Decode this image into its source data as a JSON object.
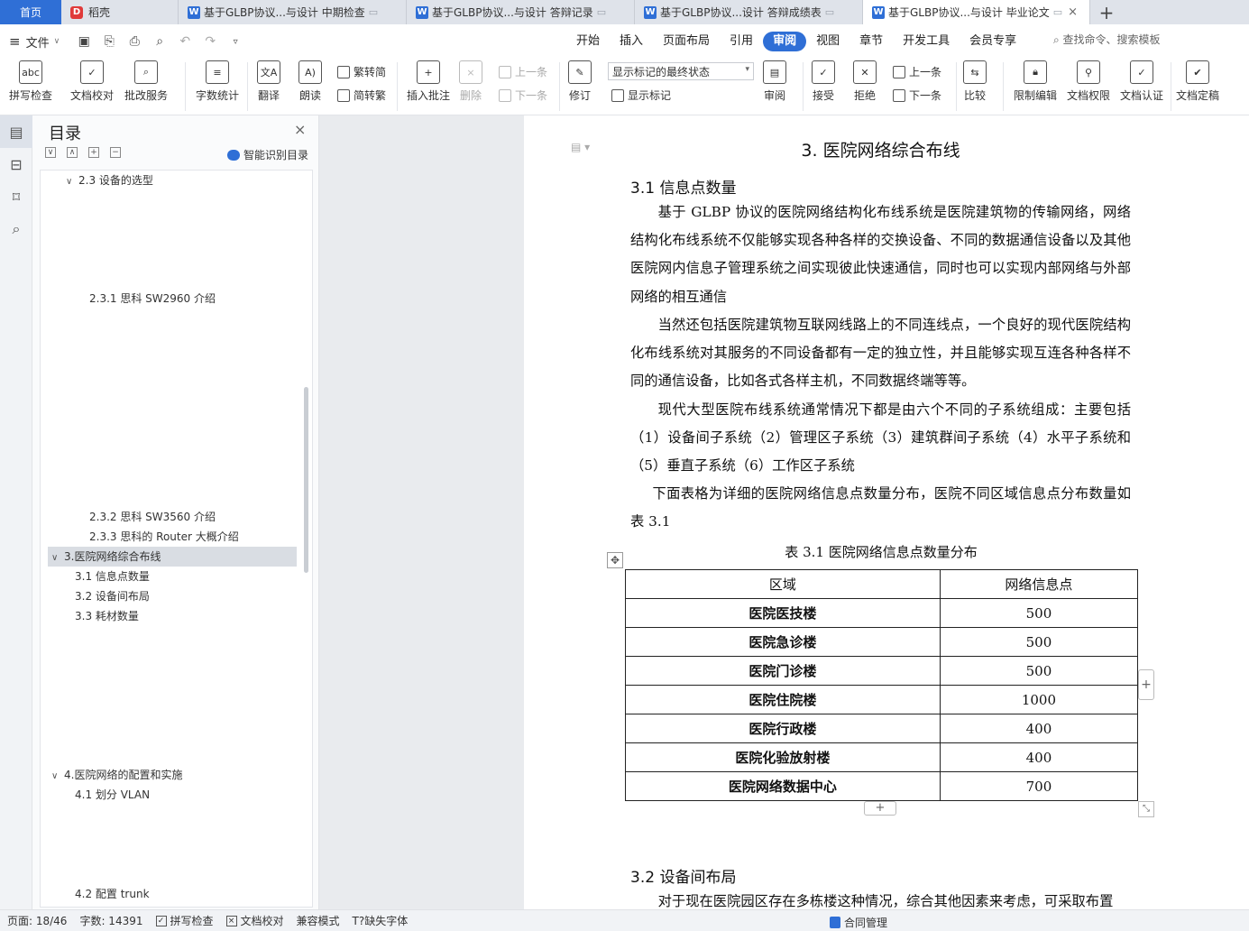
{
  "tabs": {
    "home": "首页",
    "daoke": "稻壳",
    "doc1": "基于GLBP协议...与设计  中期检查",
    "doc2": "基于GLBP协议...与设计  答辩记录",
    "doc3": "基于GLBP协议...设计  答辩成绩表",
    "doc4": "基于GLBP协议...与设计  毕业论文",
    "add": "+"
  },
  "menu": {
    "file": "文件",
    "tabs": [
      "开始",
      "插入",
      "页面布局",
      "引用",
      "审阅",
      "视图",
      "章节",
      "开发工具",
      "会员专享"
    ],
    "active_tab": "审阅",
    "search": "查找命令、搜索模板"
  },
  "ribbon": {
    "spell_check": "拼写检查",
    "doc_proof": "文档校对",
    "grading": "批改服务",
    "word_count": "字数统计",
    "translate": "翻译",
    "read_aloud": "朗读",
    "trad_to_simp": "繁转简",
    "simp_to_trad": "简转繁",
    "insert_comment": "插入批注",
    "delete": "删除",
    "prev_comment": "上一条",
    "next_comment": "下一条",
    "revise": "修订",
    "markup_state": "显示标记的最终状态",
    "show_markup": "显示标记",
    "review": "审阅",
    "accept": "接受",
    "reject": "拒绝",
    "prev_change": "上一条",
    "next_change": "下一条",
    "compare": "比较",
    "restrict_edit": "限制编辑",
    "doc_permission": "文档权限",
    "doc_cert": "文档认证",
    "doc_final": "文档定稿"
  },
  "toc": {
    "title": "目录",
    "smart_label": "智能识别目录",
    "items": [
      {
        "label": "2.3 设备的选型",
        "level": 2,
        "chev": "∨"
      },
      {
        "label": "2.3.1  思科 SW2960 介绍",
        "level": 3
      },
      {
        "label": "2.3.2  思科 SW3560 介绍",
        "level": 3
      },
      {
        "label": "2.3.3  思科的 Router 大概介绍",
        "level": 3
      },
      {
        "label": "3.医院网络综合布线",
        "level": 1,
        "chev": "∨",
        "active": true
      },
      {
        "label": "3.1  信息点数量",
        "level": 2
      },
      {
        "label": "3.2  设备间布局",
        "level": 2
      },
      {
        "label": "3.3  耗材数量",
        "level": 2
      },
      {
        "label": "4.医院网络的配置和实施",
        "level": 1,
        "chev": "∨"
      },
      {
        "label": "4.1  划分 VLAN",
        "level": 2
      },
      {
        "label": "4.2  配置 trunk",
        "level": 2
      }
    ]
  },
  "document": {
    "chapter_title": "3. 医院网络综合布线",
    "section1_title": "3.1  信息点数量",
    "paragraphs": [
      "基于 GLBP 协议的医院网络结构化布线系统是医院建筑物的传输网络，网络结构化布线系统不仅能够实现各种各样的交换设备、不同的数据通信设备以及其他医院网内信息子管理系统之间实现彼此快速通信，同时也可以实现内部网络与外部网络的相互通信",
      "当然还包括医院建筑物互联网线路上的不同连线点，一个良好的现代医院结构化布线系统对其服务的不同设备都有一定的独立性，并且能够实现互连各种各样不同的通信设备，比如各式各样主机，不同数据终端等等。",
      "现代大型医院布线系统通常情况下都是由六个不同的子系统组成：主要包括（1）设备间子系统（2）管理区子系统（3）建筑群间子系统（4）水平子系统和（5）垂直子系统（6）工作区子系统",
      "下面表格为详细的医院网络信息点数量分布，医院不同区域信息点分布数量如表 3.1"
    ],
    "table_caption": "表 3.1 医院网络信息点数量分布",
    "table_headers": [
      "区域",
      "网络信息点"
    ],
    "table_rows": [
      [
        "医院医技楼",
        "500"
      ],
      [
        "医院急诊楼",
        "500"
      ],
      [
        "医院门诊楼",
        "500"
      ],
      [
        "医院住院楼",
        "1000"
      ],
      [
        "医院行政楼",
        "400"
      ],
      [
        "医院化验放射楼",
        "400"
      ],
      [
        "医院网络数据中心",
        "700"
      ]
    ],
    "section2_title": "3.2  设备间布局",
    "section2_para": "对于现在医院园区存在多栋楼这种情况，综合其他因素来考虑，可采取布置"
  },
  "status": {
    "page": "页面: 18/46",
    "words": "字数: 14391",
    "spell": "拼写检查",
    "proof": "文档校对",
    "compat": "兼容模式",
    "missing_font": "缺失字体",
    "contract": "合同管理"
  }
}
